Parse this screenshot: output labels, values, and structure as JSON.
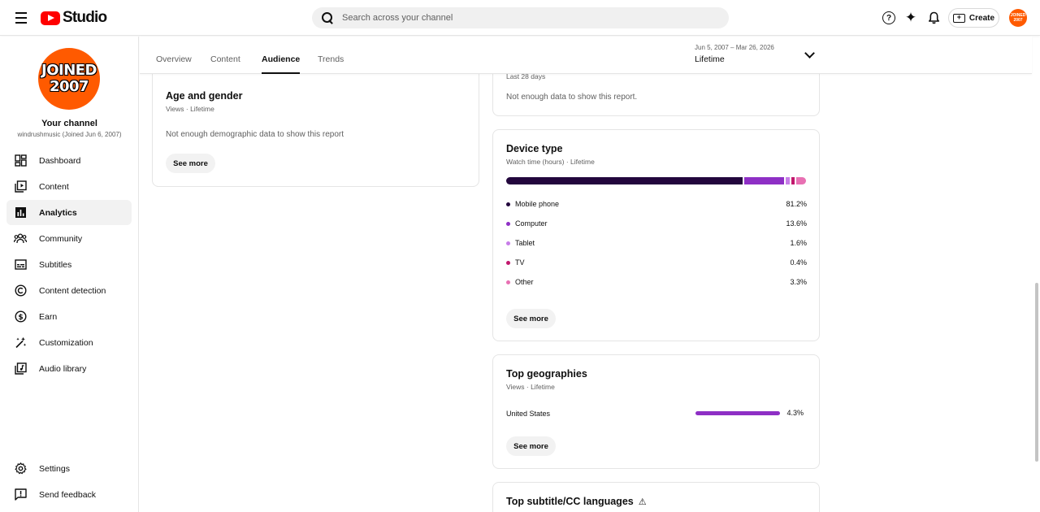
{
  "header": {
    "logo_text": "Studio",
    "search_placeholder": "Search across your channel",
    "help_glyph": "?",
    "sparkle_glyph": "✦",
    "create_label": "Create",
    "avatar_line1": "JOINED",
    "avatar_line2": "2007"
  },
  "sidebar": {
    "avatar_line1": "JOINED",
    "avatar_line2": "2007",
    "channel_title": "Your channel",
    "channel_sub": "windrushmusic (Joined Jun 6, 2007)",
    "items": [
      {
        "label": "Dashboard"
      },
      {
        "label": "Content"
      },
      {
        "label": "Analytics"
      },
      {
        "label": "Community"
      },
      {
        "label": "Subtitles"
      },
      {
        "label": "Content detection"
      },
      {
        "label": "Earn"
      },
      {
        "label": "Customization"
      },
      {
        "label": "Audio library"
      }
    ],
    "bottom_items": [
      {
        "label": "Settings"
      },
      {
        "label": "Send feedback"
      }
    ]
  },
  "tabs": [
    {
      "label": "Overview"
    },
    {
      "label": "Content"
    },
    {
      "label": "Audience"
    },
    {
      "label": "Trends"
    }
  ],
  "date_range": {
    "range": "Jun 5, 2007 – Mar 26, 2026",
    "label": "Lifetime"
  },
  "cards": {
    "age_gender": {
      "title": "Age and gender",
      "sub": "Views · Lifetime",
      "message": "Not enough demographic data to show this report",
      "see_more": "See more"
    },
    "top_partial": {
      "sub": "Last 28 days",
      "message": "Not enough data to show this report."
    },
    "device_type": {
      "title": "Device type",
      "sub": "Watch time (hours) · Lifetime",
      "segments": [
        {
          "name": "Mobile phone",
          "percent": 81.2,
          "label": "81.2%",
          "color": "#23073d"
        },
        {
          "name": "Computer",
          "percent": 13.6,
          "label": "13.6%",
          "color": "#8e2fc5"
        },
        {
          "name": "Tablet",
          "percent": 1.6,
          "label": "1.6%",
          "color": "#c77de8"
        },
        {
          "name": "TV",
          "percent": 0.4,
          "label": "0.4%",
          "color": "#c2186d"
        },
        {
          "name": "Other",
          "percent": 3.3,
          "label": "3.3%",
          "color": "#e870b3"
        }
      ],
      "see_more": "See more"
    },
    "top_geographies": {
      "title": "Top geographies",
      "sub": "Views · Lifetime",
      "rows": [
        {
          "country": "United States",
          "percent": 4.3,
          "label": "4.3%"
        }
      ],
      "see_more": "See more"
    },
    "subtitle_languages": {
      "title": "Top subtitle/CC languages",
      "warning_glyph": "⚠"
    }
  }
}
